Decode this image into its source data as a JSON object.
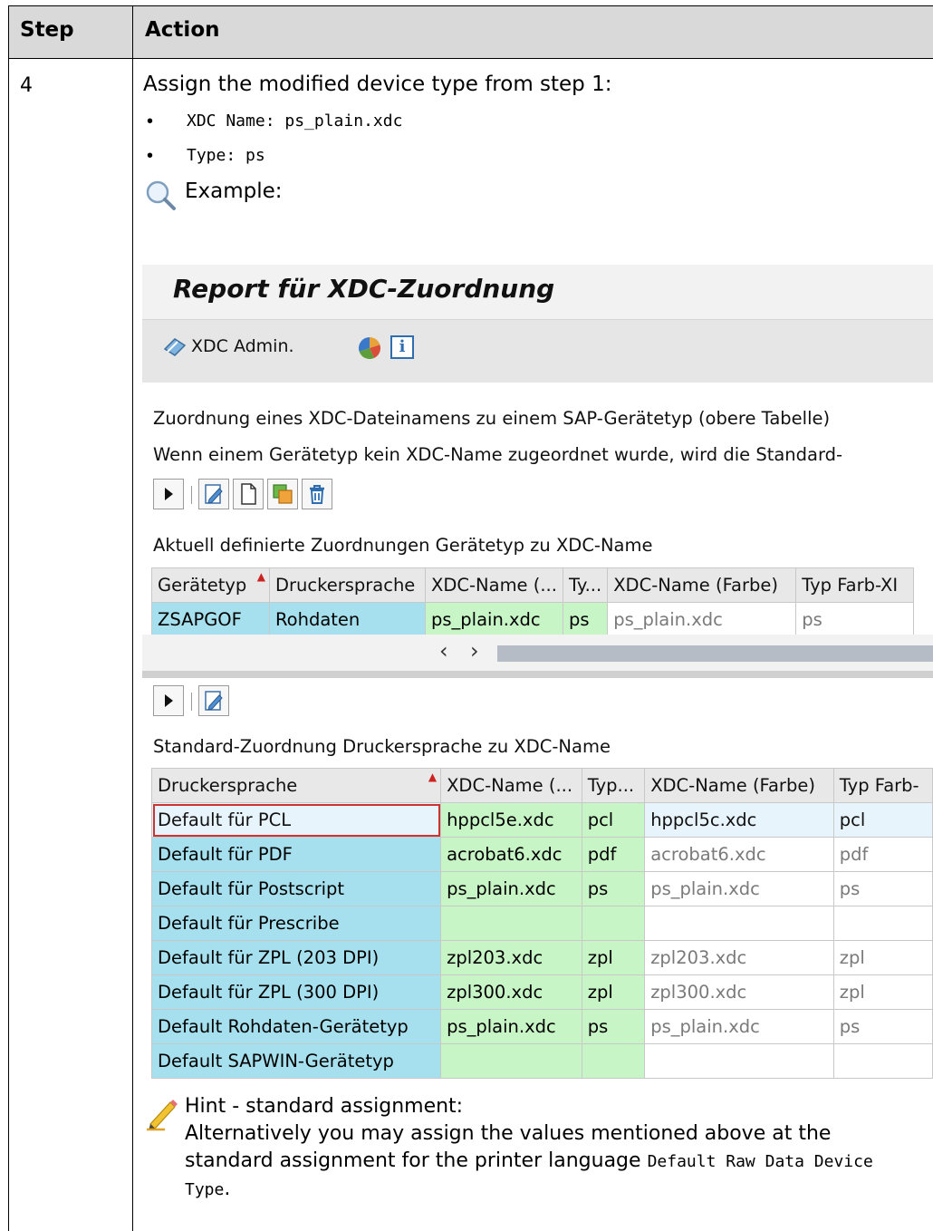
{
  "table_header": {
    "step": "Step",
    "action": "Action"
  },
  "step_number": "4",
  "intro": "Assign the modified device type from step 1:",
  "bullets": [
    {
      "label": "XDC Name: ",
      "value": "ps_plain.xdc"
    },
    {
      "label": "Type: ",
      "value": "ps"
    }
  ],
  "example_label": "Example:",
  "sap": {
    "title": "Report für XDC-Zuordnung",
    "toolbar_admin": "XDC Admin.",
    "desc1": "Zuordnung eines XDC-Dateinamens zu einem SAP-Gerätetyp (obere Tabelle)",
    "desc2": "Wenn einem Gerätetyp kein XDC-Name zugeordnet wurde, wird die Standard-",
    "table1_caption": "Aktuell definierte Zuordnungen Gerätetyp zu XDC-Name",
    "table1_headers": [
      "Gerätetyp",
      "Druckersprache",
      "XDC-Name (...",
      "Ty...",
      "XDC-Name (Farbe)",
      "Typ Farb-XI"
    ],
    "table1_rows": [
      [
        "ZSAPGOF",
        "Rohdaten",
        "ps_plain.xdc",
        "ps",
        "ps_plain.xdc",
        "ps"
      ]
    ],
    "table2_caption": "Standard-Zuordnung Druckersprache zu XDC-Name",
    "table2_headers": [
      "Druckersprache",
      "XDC-Name (...",
      "Typ...",
      "XDC-Name (Farbe)",
      "Typ Farb-"
    ],
    "table2_rows": [
      [
        "Default für PCL",
        "hppcl5e.xdc",
        "pcl",
        "hppcl5c.xdc",
        "pcl"
      ],
      [
        "Default für PDF",
        "acrobat6.xdc",
        "pdf",
        "acrobat6.xdc",
        "pdf"
      ],
      [
        "Default für Postscript",
        "ps_plain.xdc",
        "ps",
        "ps_plain.xdc",
        "ps"
      ],
      [
        "Default für Prescribe",
        "",
        "",
        "",
        ""
      ],
      [
        "Default für ZPL (203 DPI)",
        "zpl203.xdc",
        "zpl",
        "zpl203.xdc",
        "zpl"
      ],
      [
        "Default für ZPL (300 DPI)",
        "zpl300.xdc",
        "zpl",
        "zpl300.xdc",
        "zpl"
      ],
      [
        "Default Rohdaten-Gerätetyp",
        "ps_plain.xdc",
        "ps",
        "ps_plain.xdc",
        "ps"
      ],
      [
        "Default SAPWIN-Gerätetyp",
        "",
        "",
        "",
        ""
      ]
    ],
    "scroll_left": "‹",
    "scroll_right": "›"
  },
  "hint": {
    "title": "Hint - standard assignment:",
    "text_before": "Alternatively you may assign the values mentioned above at the standard assignment for the printer language ",
    "code": "Default Raw Data Device Type",
    "text_after": "."
  }
}
